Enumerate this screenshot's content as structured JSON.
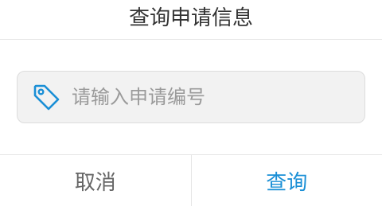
{
  "dialog": {
    "title": "查询申请信息",
    "search": {
      "placeholder": "请输入申请编号",
      "value": "",
      "icon": "tag-icon"
    },
    "buttons": {
      "cancel_label": "取消",
      "confirm_label": "查询"
    }
  },
  "colors": {
    "accent": "#1a8fd6",
    "title_text": "#333333",
    "cancel_text": "#666666",
    "placeholder_text": "#9a9a9a",
    "input_background": "#f2f2f2",
    "divider": "#e6e6e6"
  }
}
